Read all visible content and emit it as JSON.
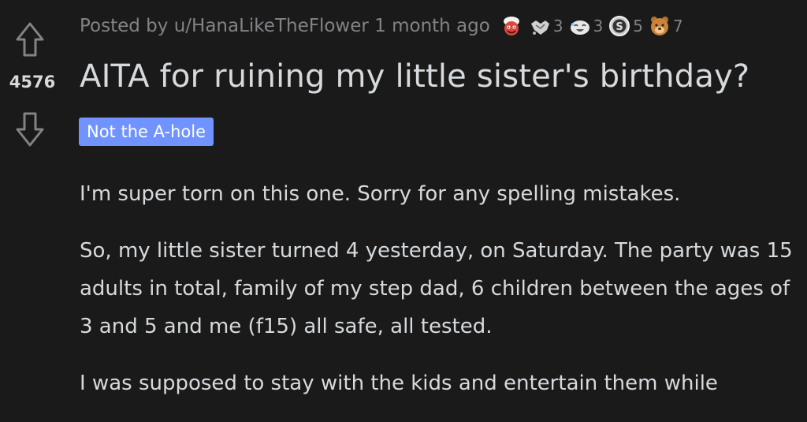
{
  "post": {
    "meta": {
      "posted_by": "Posted by u/HanaLikeTheFlower 1 month ago"
    },
    "awards": [
      {
        "icon": "wholesome-award-icon",
        "count": ""
      },
      {
        "icon": "handshake-award-icon",
        "count": "3"
      },
      {
        "icon": "laughing-award-icon",
        "count": "3"
      },
      {
        "icon": "silver-award-icon",
        "count": "5"
      },
      {
        "icon": "bear-award-icon",
        "count": "7"
      }
    ],
    "score": "4576",
    "title": "AITA for ruining my little sister's birthday?",
    "flair": "Not the A-hole",
    "paragraphs": [
      "I'm super torn on this one. Sorry for any spelling mistakes.",
      "So, my little sister turned 4 yesterday, on Saturday. The party was 15 adults in total, family of my step dad, 6 children between the ages of 3 and 5 and me (f15) all safe, all tested.",
      "I was supposed to stay with the kids and entertain them while"
    ]
  },
  "colors": {
    "background": "#1a1a1b",
    "text": "#d7dadc",
    "meta": "#818384",
    "flair": "#7193ff"
  }
}
